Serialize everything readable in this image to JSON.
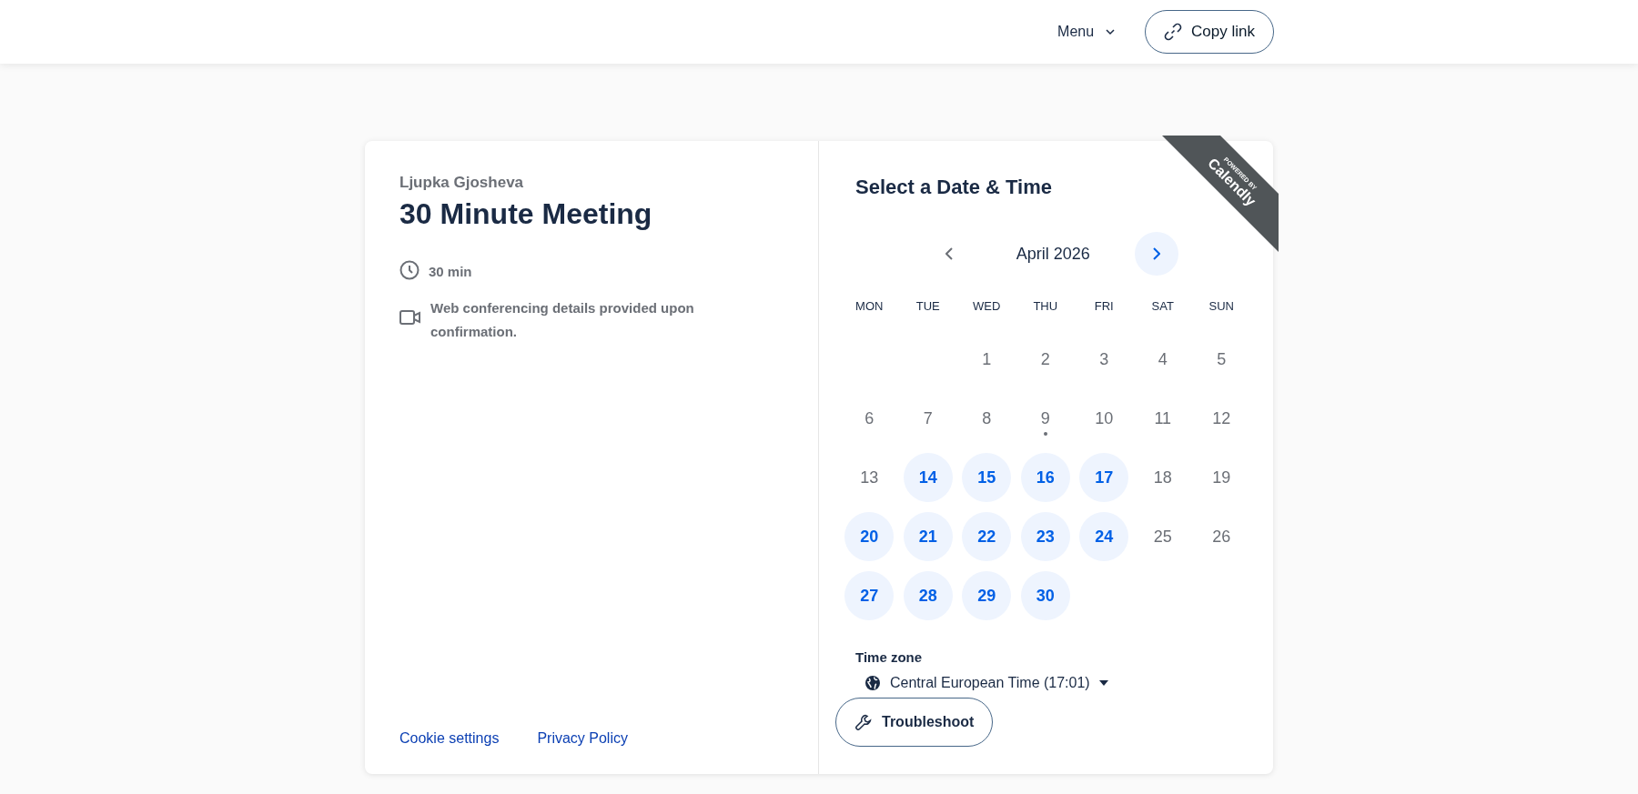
{
  "header": {
    "menu": "Menu",
    "copy_link": "Copy link"
  },
  "event": {
    "host": "Ljupka Gjosheva",
    "title": "30 Minute Meeting",
    "duration": "30 min",
    "location": "Web conferencing details provided upon confirmation."
  },
  "footer_links": [
    "Cookie settings",
    "Privacy Policy"
  ],
  "ribbon": {
    "top": "POWERED BY",
    "brand": "Calendly"
  },
  "calendar": {
    "heading": "Select a Date & Time",
    "month": "April 2026",
    "prev_enabled": false,
    "next_enabled": true,
    "weekdays": [
      "MON",
      "TUE",
      "WED",
      "THU",
      "FRI",
      "SAT",
      "SUN"
    ],
    "weeks": [
      {
        "days": [
          {
            "label": "1",
            "available": false,
            "today": false
          },
          {
            "label": "2",
            "available": false,
            "today": false
          },
          {
            "label": "3",
            "available": false,
            "today": false
          },
          {
            "label": "4",
            "available": false,
            "today": false
          },
          {
            "label": "5",
            "available": false,
            "today": false
          }
        ]
      },
      {
        "days": [
          {
            "label": "6",
            "available": false,
            "today": false
          },
          {
            "label": "7",
            "available": false,
            "today": false
          },
          {
            "label": "8",
            "available": false,
            "today": false
          },
          {
            "label": "9",
            "available": false,
            "today": true
          },
          {
            "label": "10",
            "available": false,
            "today": false
          },
          {
            "label": "11",
            "available": false,
            "today": false
          },
          {
            "label": "12",
            "available": false,
            "today": false
          }
        ]
      },
      {
        "days": [
          {
            "label": "13",
            "available": false,
            "today": false
          },
          {
            "label": "14",
            "available": true,
            "today": false
          },
          {
            "label": "15",
            "available": true,
            "today": false
          },
          {
            "label": "16",
            "available": true,
            "today": false
          },
          {
            "label": "17",
            "available": true,
            "today": false
          },
          {
            "label": "18",
            "available": false,
            "today": false
          },
          {
            "label": "19",
            "available": false,
            "today": false
          }
        ]
      },
      {
        "days": [
          {
            "label": "20",
            "available": true,
            "today": false
          },
          {
            "label": "21",
            "available": true,
            "today": false
          },
          {
            "label": "22",
            "available": true,
            "today": false
          },
          {
            "label": "23",
            "available": true,
            "today": false
          },
          {
            "label": "24",
            "available": true,
            "today": false
          },
          {
            "label": "25",
            "available": false,
            "today": false
          },
          {
            "label": "26",
            "available": false,
            "today": false
          }
        ]
      },
      {
        "days": [
          {
            "label": "27",
            "available": true,
            "today": false
          },
          {
            "label": "28",
            "available": true,
            "today": false
          },
          {
            "label": "29",
            "available": true,
            "today": false
          },
          {
            "label": "30",
            "available": true,
            "today": false
          }
        ]
      }
    ]
  },
  "timezone": {
    "label": "Time zone",
    "value": "Central European Time (17:01)"
  },
  "troubleshoot": "Troubleshoot"
}
